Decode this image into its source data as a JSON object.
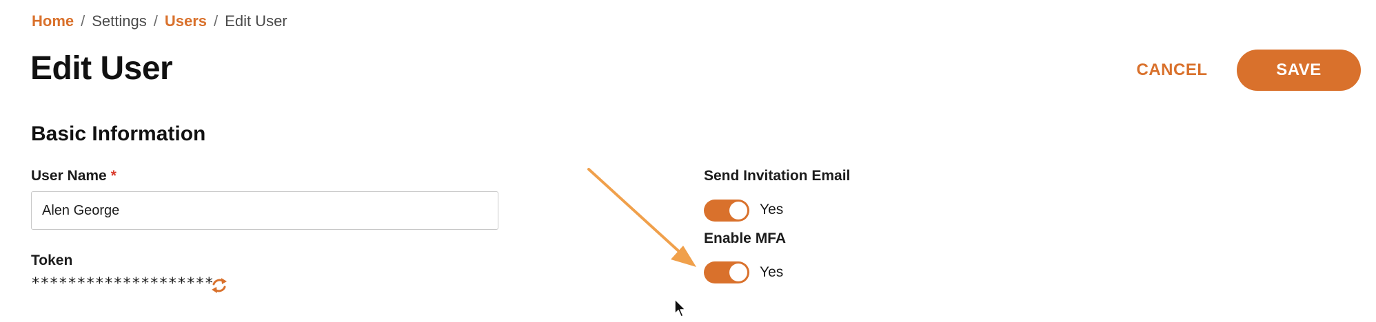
{
  "breadcrumb": {
    "home": "Home",
    "settings": "Settings",
    "users": "Users",
    "current": "Edit User",
    "separator": "/"
  },
  "header": {
    "title": "Edit User",
    "cancel_label": "CANCEL",
    "save_label": "SAVE"
  },
  "section": {
    "heading": "Basic Information"
  },
  "form": {
    "user_name": {
      "label": "User Name",
      "required_marker": "*",
      "value": "Alen George"
    },
    "token": {
      "label": "Token",
      "value": "********************"
    },
    "send_invitation_email": {
      "label": "Send Invitation Email",
      "toggle_text": "Yes",
      "enabled": true
    },
    "enable_mfa": {
      "label": "Enable MFA",
      "toggle_text": "Yes",
      "enabled": true
    }
  },
  "icons": {
    "refresh": "refresh-icon",
    "arrow": "arrow-annotation",
    "cursor": "mouse-cursor-icon"
  },
  "colors": {
    "accent": "#d9712c",
    "required": "#d93a2b",
    "arrow": "#f0a04b"
  }
}
